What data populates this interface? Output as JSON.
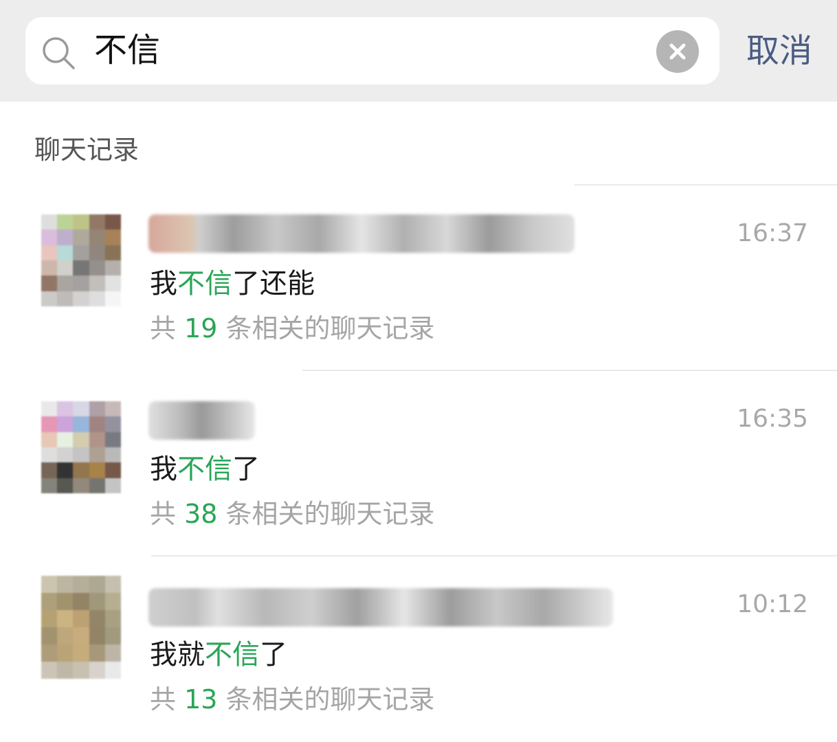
{
  "search": {
    "query": "不信",
    "cancel_label": "取消"
  },
  "section": {
    "title": "聊天记录"
  },
  "results": [
    {
      "time": "16:37",
      "snippet_before": "我",
      "snippet_highlight": "不信",
      "snippet_after": "了还能",
      "count_prefix": "共 ",
      "count": "19",
      "count_suffix": " 条相关的聊天记录"
    },
    {
      "time": "16:35",
      "snippet_before": "我",
      "snippet_highlight": "不信",
      "snippet_after": "了",
      "count_prefix": "共 ",
      "count": "38",
      "count_suffix": " 条相关的聊天记录"
    },
    {
      "time": "10:12",
      "snippet_before": "我就",
      "snippet_highlight": "不信",
      "snippet_after": "了",
      "count_prefix": "共 ",
      "count": "13",
      "count_suffix": " 条相关的聊天记录"
    }
  ],
  "colors": {
    "highlight": "#2aa557",
    "cancel": "#4a5c82",
    "header_bg": "#ededed"
  },
  "icons": [
    "search-icon",
    "clear-icon"
  ]
}
